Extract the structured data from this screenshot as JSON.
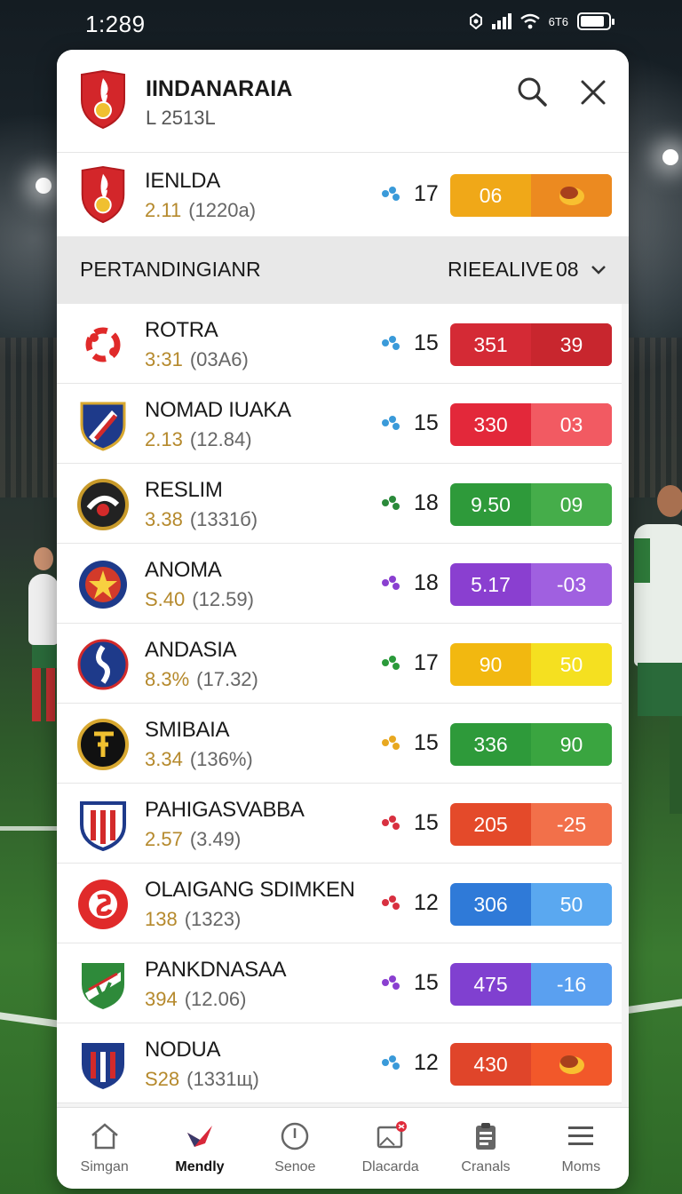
{
  "status": {
    "time": "1:289",
    "network": "6T6"
  },
  "header": {
    "title": "IINDANARAIA",
    "subtitle": "L 2513L"
  },
  "featured": {
    "name": "IENLDA",
    "rating": "2.11",
    "detail": "(1220а)",
    "count": "17",
    "score_left": "06",
    "pill_colors": [
      "#f0a818",
      "#ec8a20"
    ]
  },
  "section": {
    "label": "PERTANDINGIANR",
    "filter": "RIEEALIVE",
    "count": "08"
  },
  "teams": [
    {
      "name": "ROTRA",
      "rating": "3:31",
      "detail": "(03A6)",
      "count": "15",
      "left": "351",
      "right": "39",
      "color": "#d42a35",
      "dots_color": "#3a9ad9",
      "logo": "red-swirl"
    },
    {
      "name": "NOMAD IUAKA",
      "rating": "2.13",
      "detail": "(12.84)",
      "count": "15",
      "left": "330",
      "right": "03",
      "color": "#e3283a",
      "dots_color": "#3a9ad9",
      "logo": "blue-shield"
    },
    {
      "name": "RESLIM",
      "rating": "3.38",
      "detail": "(1331б)",
      "count": "18",
      "left": "9.50",
      "right": "09",
      "color": "#2e9a3a",
      "dots_color": "#2a8a3a",
      "logo": "dark-round"
    },
    {
      "name": "ANOMA",
      "rating": "S.40",
      "detail": "(12.59)",
      "count": "18",
      "left": "5.17",
      "right": "-03",
      "color": "#8a3fd0",
      "dots_color": "#8a3fd0",
      "logo": "star-round"
    },
    {
      "name": "ANDASIA",
      "rating": "8.3%",
      "detail": "(17.32)",
      "count": "17",
      "left": "90",
      "right": "50",
      "color": "#f2b810",
      "dots_color": "#2a9a3a",
      "logo": "blue-round"
    },
    {
      "name": "SMIBAIA",
      "rating": "3.34",
      "detail": "(136%)",
      "count": "15",
      "left": "336",
      "right": "90",
      "color": "#2e9a3a",
      "dots_color": "#e8a820",
      "logo": "gold-round"
    },
    {
      "name": "PAHIGASVABBA",
      "rating": "2.57",
      "detail": "(3.49)",
      "count": "15",
      "left": "205",
      "right": "-25",
      "color": "#e44a2a",
      "dots_color": "#d83040",
      "logo": "striped-shield"
    },
    {
      "name": "OLAIGANG SDIMKEN",
      "rating": "138",
      "detail": "(1323)",
      "count": "12",
      "left": "306",
      "right": "50",
      "color": "#2f7ad8",
      "dots_color": "#d83040",
      "logo": "red-round"
    },
    {
      "name": "PANKDNASAA",
      "rating": "394",
      "detail": "(12.06)",
      "count": "15",
      "left": "475",
      "right": "-16",
      "color": "#8040d0",
      "dots_color": "#8a3fd0",
      "logo": "green-shield"
    },
    {
      "name": "NODUA",
      "rating": "S28",
      "detail": "(1331щ)",
      "count": "12",
      "left": "430",
      "right": "",
      "color": "#e0452a",
      "dots_color": "#3a9ad9",
      "logo": "navy-shield"
    }
  ],
  "nav": [
    {
      "label": "Simgan",
      "icon": "home-icon"
    },
    {
      "label": "Mendly",
      "icon": "bird-icon"
    },
    {
      "label": "Senoe",
      "icon": "clock-icon"
    },
    {
      "label": "Dlacarda",
      "icon": "image-icon"
    },
    {
      "label": "Cranals",
      "icon": "clipboard-icon"
    },
    {
      "label": "Moms",
      "icon": "menu-icon"
    }
  ]
}
